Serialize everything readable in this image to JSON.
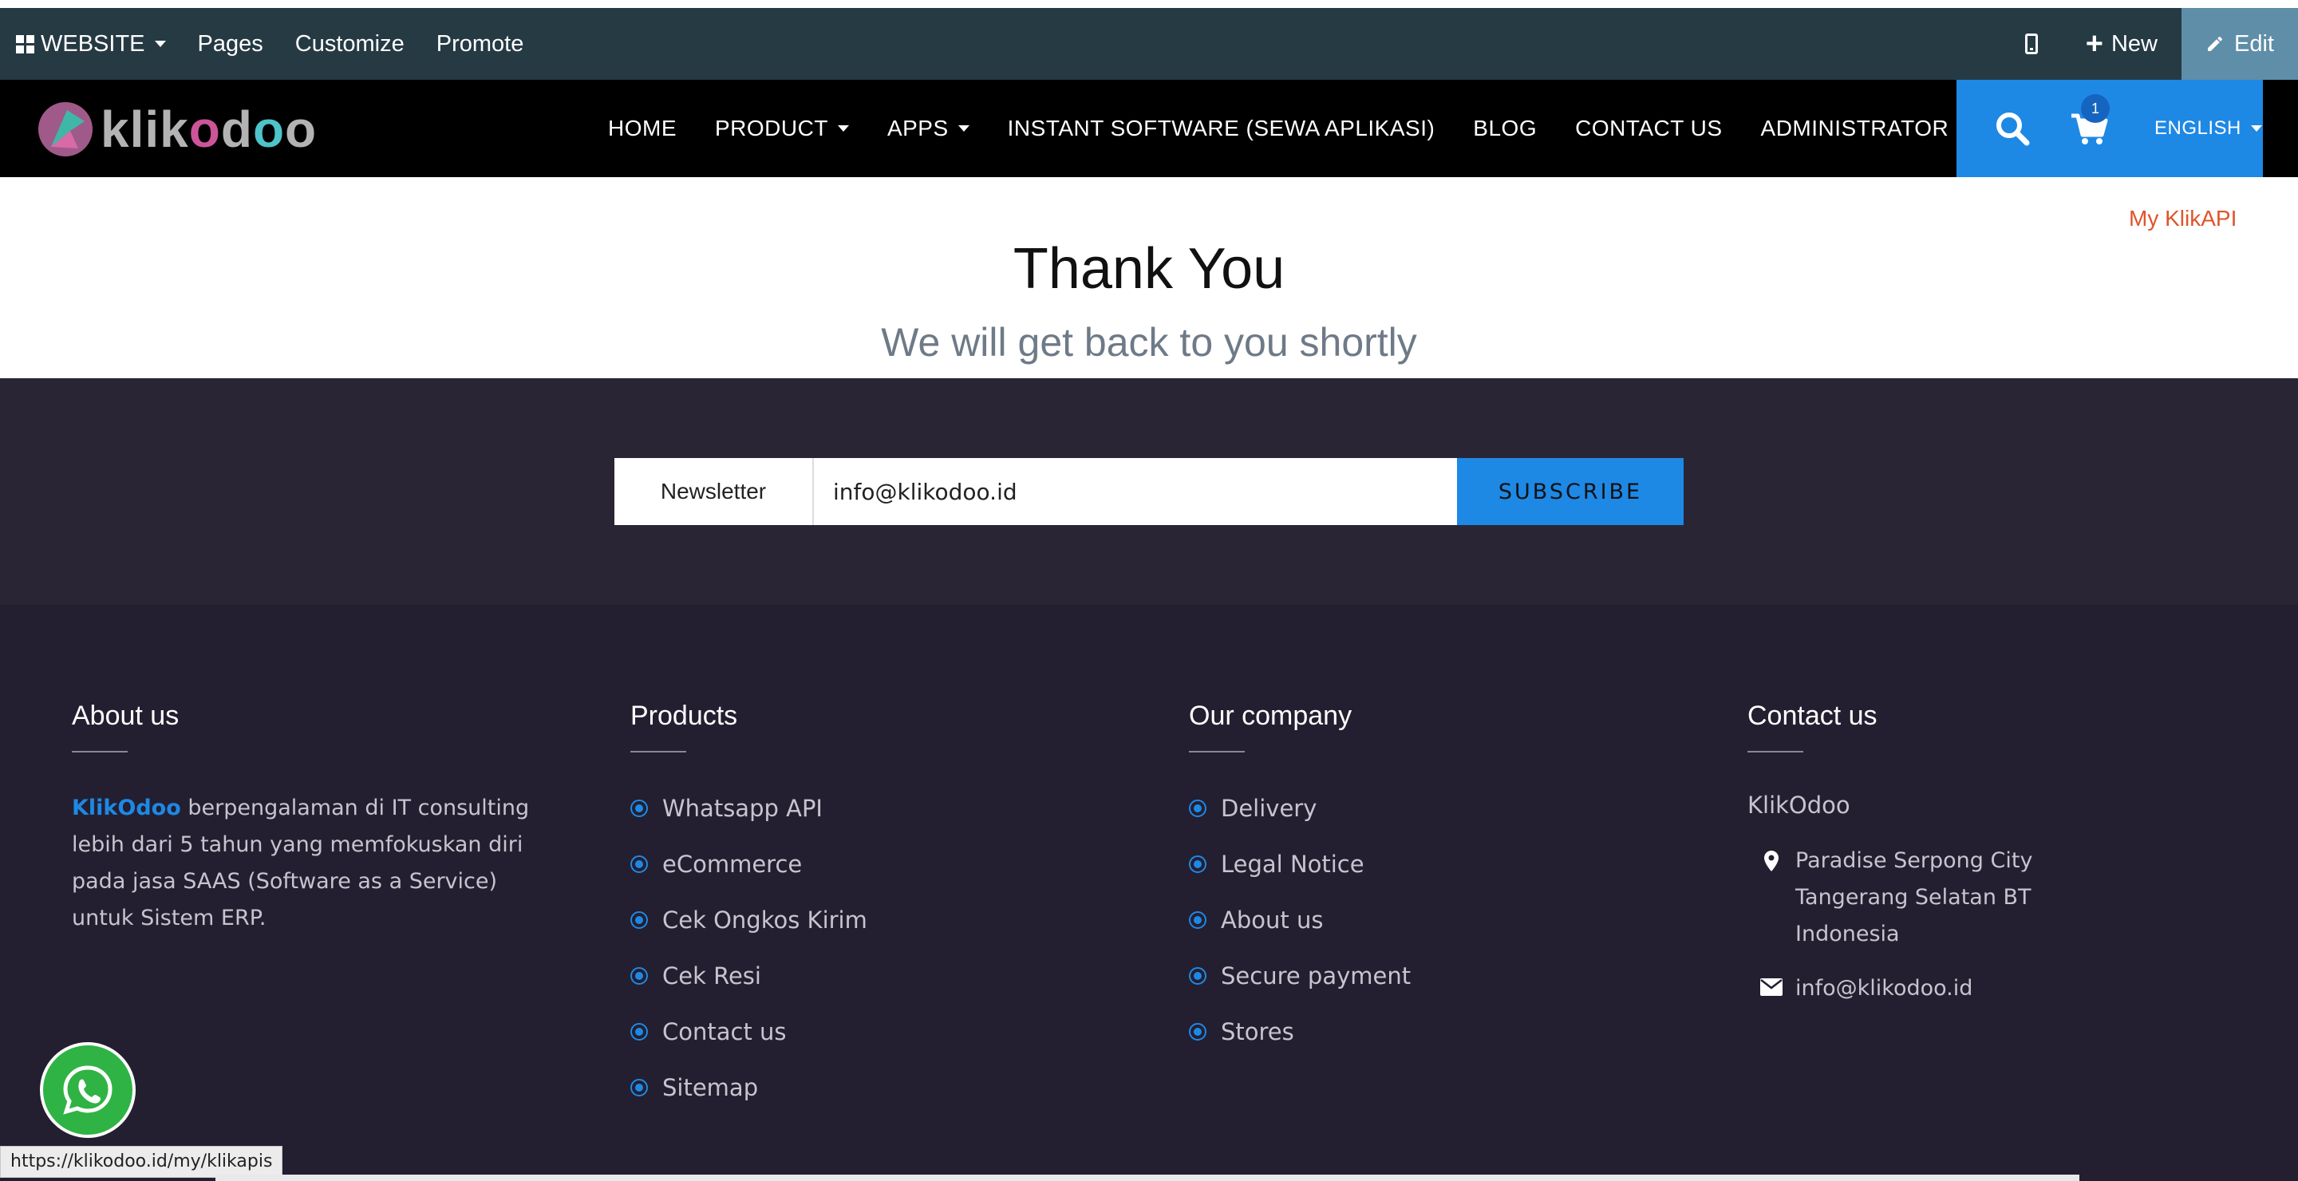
{
  "admin_bar": {
    "website_label": "WEBSITE",
    "menu": [
      "Pages",
      "Customize",
      "Promote"
    ],
    "new_label": "New",
    "edit_label": "Edit"
  },
  "nav": {
    "logo_text": "klikodoo",
    "links": [
      "HOME",
      "PRODUCT",
      "APPS",
      "INSTANT SOFTWARE (SEWA APLIKASI)",
      "BLOG",
      "CONTACT US",
      "ADMINISTRATOR"
    ],
    "cart_count": "1",
    "language": "ENGLISH"
  },
  "hero": {
    "my_klikapi": "My KlikAPI",
    "title": "Thank You",
    "subtitle": "We will get back to you shortly"
  },
  "newsletter": {
    "label": "Newsletter",
    "input_value": "info@klikodoo.id",
    "button": "SUBSCRIBE"
  },
  "footer": {
    "about": {
      "title": "About us",
      "brand": "KlikOdoo",
      "text": " berpengalaman di IT consulting lebih dari 5 tahun yang memfokuskan diri pada jasa SAAS (Software as a Service) untuk Sistem ERP."
    },
    "products": {
      "title": "Products",
      "items": [
        "Whatsapp API",
        "eCommerce",
        "Cek Ongkos Kirim",
        "Cek Resi",
        "Contact us",
        "Sitemap"
      ]
    },
    "company": {
      "title": "Our company",
      "items": [
        "Delivery",
        "Legal Notice",
        "About us",
        "Secure payment",
        "Stores"
      ]
    },
    "contact": {
      "title": "Contact us",
      "name": "KlikOdoo",
      "address_lines": [
        "Paradise Serpong City",
        "Tangerang Selatan BT",
        "Indonesia"
      ],
      "email": "info@klikodoo.id"
    }
  },
  "status_bar": {
    "url": "https://klikodoo.id/my/klikapis"
  },
  "colors": {
    "admin_bar": "#263a44",
    "accent_blue": "#1e88e5",
    "footer_bg": "#231f30",
    "link_orange": "#e0542a",
    "whatsapp_green": "#2fb344"
  }
}
